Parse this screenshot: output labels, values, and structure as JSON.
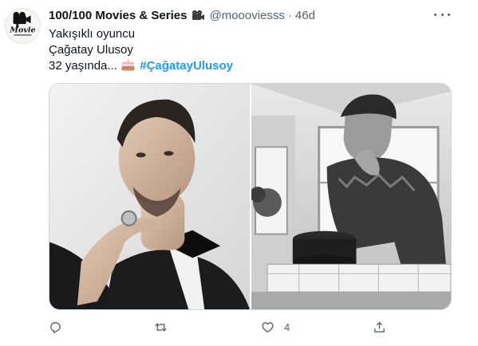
{
  "tweet": {
    "display_name": "100/100 Movies & Series",
    "handle": "@moooviesss",
    "separator": "·",
    "timestamp": "46d",
    "avatar_text": "Movie",
    "lines": [
      "Yakışıklı oyuncu",
      "Çağatay Ulusoy",
      "32 yaşında..."
    ],
    "hashtag": "#ÇağatayUlusoy",
    "icons": {
      "name_emoji": "movie-camera-icon",
      "text_emoji": "birthday-cake-icon",
      "more": "more-options-icon"
    },
    "actions": {
      "reply": {
        "icon": "reply-icon",
        "count": ""
      },
      "retweet": {
        "icon": "retweet-icon",
        "count": ""
      },
      "like": {
        "icon": "like-icon",
        "count": "4"
      },
      "share": {
        "icon": "share-icon",
        "count": ""
      }
    },
    "colors": {
      "text": "#0f1419",
      "secondary": "#536471",
      "link": "#1d9bf0"
    }
  }
}
